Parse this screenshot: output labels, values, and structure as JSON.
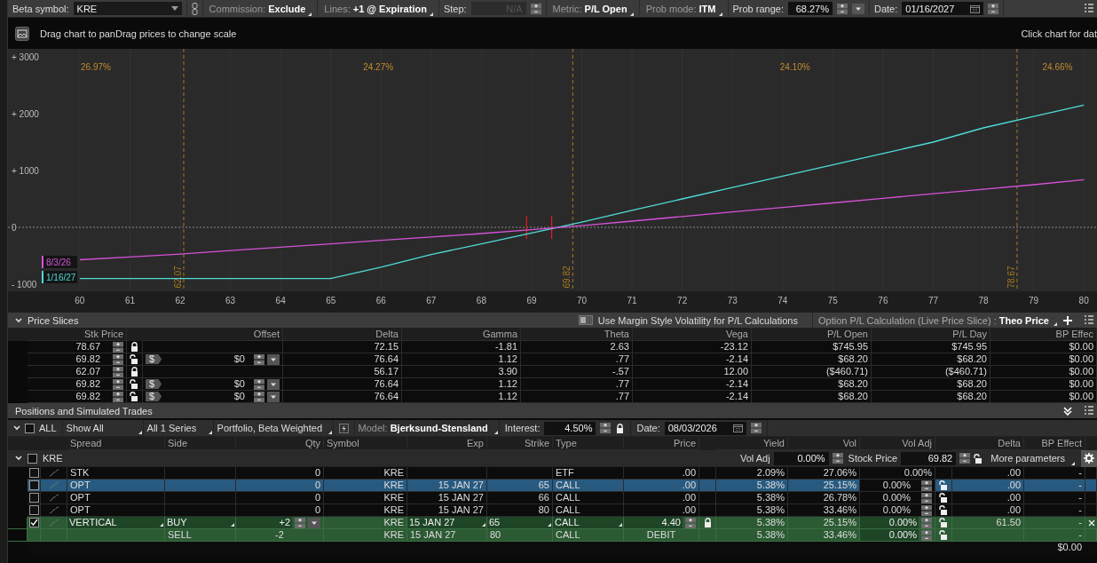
{
  "toolbar": {
    "items": [
      {
        "kind": "select",
        "label": "Beta symbol:",
        "value": "KRE"
      },
      {
        "kind": "link"
      },
      {
        "kind": "option",
        "label": "Commission:",
        "value": "Exclude"
      },
      {
        "kind": "option",
        "label": "Lines:",
        "value": "+1 @ Expiration"
      },
      {
        "kind": "spin_field",
        "label": "Step:",
        "placeholder": "N/A",
        "disabled": true
      },
      {
        "kind": "option",
        "label": "Metric:",
        "value": "P/L Open"
      },
      {
        "kind": "option",
        "label": "Prob mode:",
        "value": "ITM"
      },
      {
        "kind": "spin_field",
        "label": "Prob range:",
        "value": "68.27%",
        "disabled": false,
        "dropdown": true
      },
      {
        "kind": "date_field",
        "label": "Date:",
        "value": "01/16/2027"
      }
    ]
  },
  "chart": {
    "hint": "Drag chart to panDrag prices to change scale",
    "hint_right": "Click chart for dat",
    "probabilities": [
      "26.97%",
      "24.27%",
      "24.10%",
      "24.66%"
    ],
    "chart_data": {
      "type": "line",
      "x": [
        60,
        61,
        62,
        63,
        64,
        65,
        66,
        67,
        68,
        69,
        70,
        71,
        72,
        73,
        74,
        75,
        76,
        77,
        78,
        79,
        80
      ],
      "series": [
        {
          "name": "1/16/27",
          "color": "#4fdcd8",
          "values": [
            -900,
            -900,
            -900,
            -900,
            -900,
            -900,
            -700,
            -480,
            -290,
            -100,
            90,
            300,
            500,
            700,
            900,
            1100,
            1300,
            1500,
            1750,
            1950,
            2150
          ]
        },
        {
          "name": "8/3/26",
          "color": "#d552d8",
          "values": [
            -570,
            -520,
            -470,
            -410,
            -350,
            -290,
            -230,
            -170,
            -110,
            -40,
            30,
            110,
            190,
            270,
            350,
            430,
            510,
            590,
            670,
            750,
            840
          ]
        }
      ],
      "xlim": [
        58.57,
        80.28
      ],
      "ylim": [
        -1125,
        3141
      ],
      "xticks": [
        60,
        61,
        62,
        63,
        64,
        65,
        66,
        67,
        68,
        69,
        70,
        71,
        72,
        73,
        74,
        75,
        76,
        77,
        78,
        79,
        80
      ],
      "yticks": [
        {
          "value": 3000,
          "label": "+ 3000"
        },
        {
          "value": 2000,
          "label": "+ 2000"
        },
        {
          "value": 1000,
          "label": "+ 1000"
        },
        {
          "value": 0,
          "label": "0"
        },
        {
          "value": -1000,
          "label": "- 1000"
        }
      ],
      "grid": true,
      "legend": "lower left",
      "ref_lines": [
        {
          "axis": "y",
          "value": 0,
          "color": "#8a8a8a"
        },
        {
          "axis": "x",
          "value": 62.07,
          "label": "62.07",
          "color": "#a87a1e"
        },
        {
          "axis": "x",
          "value": 69.82,
          "label": "69.82",
          "color": "#a87a1e"
        },
        {
          "axis": "x",
          "value": 78.67,
          "label": "78.67",
          "color": "#a87a1e"
        },
        {
          "axis": "x",
          "value": 68.9,
          "color": "#e02020"
        },
        {
          "axis": "x",
          "value": 69.4,
          "color": "#e02020"
        }
      ]
    }
  },
  "price_slices": {
    "title": "Price Slices",
    "expanded": true,
    "margin_toggle": {
      "label": "Use Margin Style Volatility for P/L Calculations",
      "on": false
    },
    "calc": {
      "label": "Option P/L Calculation (Live Price Slice) :",
      "value": "Theo Price"
    },
    "columns": [
      "Stk Price",
      "Offset",
      "Delta",
      "Gamma",
      "Theta",
      "Vega",
      "P/L Open",
      "P/L Day",
      "BP Effec"
    ],
    "rows": [
      {
        "price": "78.67",
        "locked": true,
        "delta": "72.15",
        "gamma": "-1.81",
        "theta": "2.63",
        "vega": "-23.12",
        "pl_open": "$745.95",
        "pl_day": "$745.95",
        "bp": "$0.00"
      },
      {
        "price": "69.82",
        "locked": false,
        "unit": "$",
        "offset": "$0",
        "delta": "76.64",
        "gamma": "1.12",
        "theta": ".77",
        "vega": "-2.14",
        "pl_open": "$68.20",
        "pl_day": "$68.20",
        "bp": "$0.00"
      },
      {
        "price": "62.07",
        "locked": true,
        "delta": "56.17",
        "gamma": "3.90",
        "theta": "-.57",
        "vega": "12.00",
        "pl_open": "($460.71)",
        "pl_day": "($460.71)",
        "bp": "$0.00"
      },
      {
        "price": "69.82",
        "locked": false,
        "unit": "$",
        "offset": "$0",
        "delta": "76.64",
        "gamma": "1.12",
        "theta": ".77",
        "vega": "-2.14",
        "pl_open": "$68.20",
        "pl_day": "$68.20",
        "bp": "$0.00"
      },
      {
        "price": "69.82",
        "locked": false,
        "unit": "$",
        "offset": "$0",
        "delta": "76.64",
        "gamma": "1.12",
        "theta": ".77",
        "vega": "-2.14",
        "pl_open": "$68.20",
        "pl_day": "$68.20",
        "bp": "$0.00"
      }
    ]
  },
  "positions": {
    "title": "Positions and Simulated Trades",
    "filter": {
      "all_label": "ALL",
      "all_checked": false,
      "show": "Show All",
      "series": "All 1 Series",
      "mode": "Portfolio, Beta Weighted",
      "model_label": "Model:",
      "model": "Bjerksund-Stensland",
      "interest_label": "Interest:",
      "interest": "4.50%",
      "interest_locked": true,
      "date_label": "Date:",
      "date": "08/03/2026"
    },
    "columns": [
      "Spread",
      "Side",
      "Qty",
      "Symbol",
      "Exp",
      "Strike",
      "Type",
      "Price",
      "Yield",
      "Vol",
      "Vol Adj",
      "Delta",
      "BP Effect"
    ],
    "group": {
      "symbol": "KRE",
      "checked": false,
      "vol_adj_label": "Vol Adj",
      "vol_adj": "0.00%",
      "stock_price_label": "Stock Price",
      "stock_price": "69.82",
      "stock_price_locked": false,
      "more": "More parameters"
    },
    "rows": [
      {
        "kind": "stock",
        "checked": false,
        "selected": false,
        "spread": "STK",
        "qty": "0",
        "symbol": "KRE",
        "type": "ETF",
        "price": ".00",
        "yield": "2.09%",
        "vol": "27.06%",
        "vol_adj": "0.00%",
        "delta": ".00",
        "bp": "-"
      },
      {
        "kind": "option",
        "checked": false,
        "selected": true,
        "spread": "OPT",
        "qty": "0",
        "symbol": "KRE",
        "exp": "15 JAN 27",
        "strike": "65",
        "type": "CALL",
        "price": ".00",
        "yield": "5.38%",
        "vol": "25.15%",
        "vol_adj": "0.00%",
        "vol_adj_locked": false,
        "delta": ".00",
        "bp": "-"
      },
      {
        "kind": "option",
        "checked": false,
        "selected": false,
        "spread": "OPT",
        "qty": "0",
        "symbol": "KRE",
        "exp": "15 JAN 27",
        "strike": "66",
        "type": "CALL",
        "price": ".00",
        "yield": "5.38%",
        "vol": "26.78%",
        "vol_adj": "0.00%",
        "vol_adj_locked": false,
        "delta": ".00",
        "bp": "-"
      },
      {
        "kind": "option",
        "checked": false,
        "selected": false,
        "spread": "OPT",
        "qty": "0",
        "symbol": "KRE",
        "exp": "15 JAN 27",
        "strike": "80",
        "type": "CALL",
        "price": ".00",
        "yield": "5.38%",
        "vol": "33.46%",
        "vol_adj": "0.00%",
        "vol_adj_locked": false,
        "delta": ".00",
        "bp": "-"
      },
      {
        "kind": "spread",
        "checked": true,
        "selected": false,
        "spread": "VERTICAL",
        "price": "4.40",
        "price_locked": true,
        "price_type": "DEBIT",
        "delta": "61.50",
        "legs": [
          {
            "side": "BUY",
            "qty": "+2",
            "symbol": "KRE",
            "exp": "15 JAN 27",
            "strike": "65",
            "type": "CALL",
            "yield": "5.38%",
            "vol": "25.15%",
            "vol_adj": "0.00%",
            "vol_adj_locked": false,
            "bp": "-"
          },
          {
            "side": "SELL",
            "qty": "-2",
            "symbol": "KRE",
            "exp": "15 JAN 27",
            "strike": "80",
            "type": "CALL",
            "yield": "5.38%",
            "vol": "33.46%",
            "vol_adj": "0.00%",
            "vol_adj_locked": false,
            "bp": "-"
          }
        ]
      }
    ],
    "total": "$0.00"
  }
}
